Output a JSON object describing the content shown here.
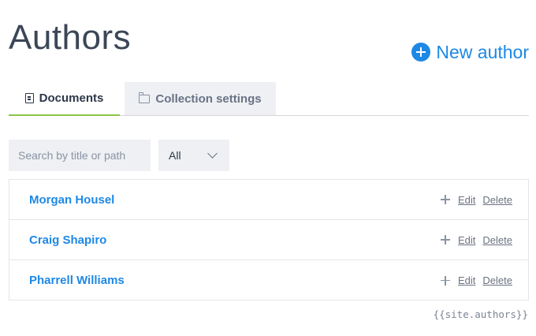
{
  "page": {
    "title": "Authors"
  },
  "header": {
    "new_author_label": "New author",
    "new_author_icon": "plus-circle-icon",
    "accent": "#1e88e5"
  },
  "tabs": [
    {
      "label": "Documents",
      "icon": "document-icon",
      "active": true
    },
    {
      "label": "Collection settings",
      "icon": "folder-icon",
      "active": false
    }
  ],
  "filters": {
    "search_placeholder": "Search by title or path",
    "search_value": "",
    "type_selected": "All"
  },
  "documents": [
    {
      "title": "Morgan Housel",
      "edit_label": "Edit",
      "delete_label": "Delete"
    },
    {
      "title": "Craig Shapiro",
      "edit_label": "Edit",
      "delete_label": "Delete"
    },
    {
      "title": "Pharrell Williams",
      "edit_label": "Edit",
      "delete_label": "Delete"
    }
  ],
  "footer": {
    "variable": "{{site.authors}}"
  }
}
